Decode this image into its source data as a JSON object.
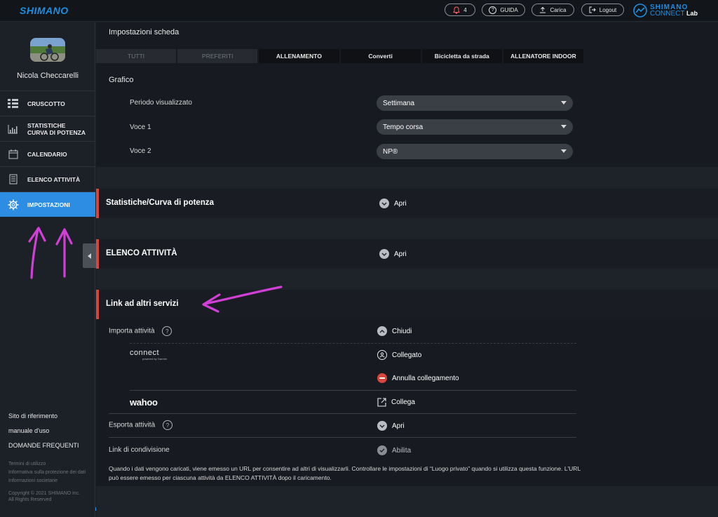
{
  "header": {
    "logo": "SHIMANO",
    "notifications_count": "4",
    "guide_label": "GUIDA",
    "upload_label": "Carica",
    "logout_label": "Logout",
    "brand_line1": "SHIMANO",
    "brand_line2": "CONNECT",
    "brand_line2_suffix": "Lab"
  },
  "sidebar": {
    "username": "Nicola Checcarelli",
    "items": [
      {
        "label": "CRUSCOTTO",
        "icon": "dashboard-icon"
      },
      {
        "label": "STATISTICHE CURVA DI POTENZA",
        "label_line1": "STATISTICHE",
        "label_line2": "CURVA DI POTENZA",
        "icon": "chart-icon"
      },
      {
        "label": "CALENDARIO",
        "icon": "calendar-icon"
      },
      {
        "label": "ELENCO ATTIVITÀ",
        "icon": "list-icon"
      },
      {
        "label": "IMPOSTAZIONI",
        "icon": "gear-icon",
        "active": true
      }
    ],
    "links": [
      "Sito di riferimento",
      "manuale d'uso",
      "DOMANDE FREQUENTI"
    ],
    "small_links": [
      "Termini di utilizzo",
      "Informativa sulla protezione dei dati",
      "Informazioni societarie"
    ],
    "copyright_line1": "Copyright © 2021 SHIMANO inc.",
    "copyright_line2": "All Rights Reserved"
  },
  "main": {
    "tab_settings_title": "Impostazioni scheda",
    "tabs": [
      "TUTTI",
      "PREFERITI",
      "ALLENAMENTO",
      "Converti",
      "Bicicletta da strada",
      "ALLENATORE INDOOR"
    ],
    "graph_title": "Grafico",
    "rows": [
      {
        "label": "Periodo visualizzato",
        "value": "Settimana"
      },
      {
        "label": "Voce 1",
        "value": "Tempo corsa"
      },
      {
        "label": "Voce 2",
        "value": "NP®"
      }
    ],
    "stats_title": "Statistiche/Curva di potenza",
    "stats_toggle": "Apri",
    "activities_title": "ELENCO ATTIVITÀ",
    "activities_toggle": "Apri",
    "links_title": "Link ad altri servizi",
    "import_label": "Importa attività",
    "import_toggle": "Chiudi",
    "garmin_logo": "connect",
    "garmin_sub": "powered by Garmin",
    "connected_label": "Collegato",
    "unlink_label": "Annulla collegamento",
    "wahoo_logo": "wahoo",
    "connect_label": "Collega",
    "export_label": "Esporta attività",
    "export_toggle": "Apri",
    "share_label": "Link di condivisione",
    "share_toggle": "Abilita",
    "note": "Quando i dati vengono caricati, viene emesso un URL per consentire ad altri di visualizzarli. Controllare le impostazioni di “Luogo privato” quando si utilizza questa funzione. L'URL può essere emesso per ciascuna attività da ELENCO ATTIVITÀ dopo il caricamento.",
    "help_glyph": "?"
  },
  "colors": {
    "accent": "#2d8de3",
    "red": "#d6463c",
    "annotation": "#d23fd6"
  }
}
